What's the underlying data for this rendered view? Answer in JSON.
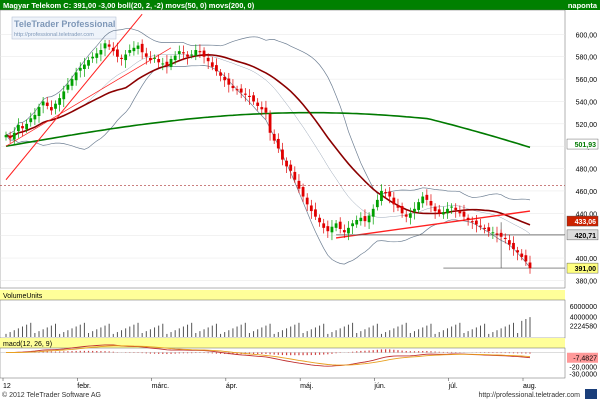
{
  "header": {
    "legend_text": "Magyar Telekom C: 391,00 -3,00 boll(20, 2, -2) movs(50, 0) movs(200, 0)",
    "timeframe": "naponta"
  },
  "watermark": {
    "brand": "TeleTrader Professional",
    "url": "http://professional.teletrader.com"
  },
  "footer": {
    "copyright": "© 2012 TeleTrader Software AG",
    "url": "http://professional.teletrader.com"
  },
  "x_axis": {
    "labels": [
      "12",
      "febr.",
      "márc.",
      "ápr.",
      "máj.",
      "jún.",
      "júl.",
      "aug."
    ]
  },
  "colors": {
    "up": "#00a000",
    "down": "#e00000",
    "ma50": "#8b0000",
    "ma200": "#007a00",
    "bollinger": "#6e7f93",
    "trendline": "#ff2020",
    "header_bg": "#008000",
    "panel_header_bg": "#ffff99",
    "price_tag": "#ffff80",
    "support_tag": "#cc2200"
  },
  "chart_data": [
    {
      "type": "candlestick",
      "title": "Magyar Telekom",
      "ylim": [
        375,
        620
      ],
      "y_ticks": [
        "600,00",
        "580,00",
        "560,00",
        "540,00",
        "520,00",
        "500,00",
        "480,00",
        "460,00",
        "440,00",
        "420,00",
        "400,00",
        "380,00"
      ],
      "y_tick_values": [
        600,
        580,
        560,
        540,
        520,
        500,
        480,
        460,
        440,
        420,
        400,
        380
      ],
      "close_series": [
        510,
        507,
        512,
        519,
        516,
        520,
        525,
        528,
        535,
        540,
        536,
        532,
        538,
        543,
        549,
        555,
        560,
        566,
        570,
        573,
        577,
        580,
        583,
        586,
        592,
        589,
        585,
        580,
        578,
        582,
        586,
        588,
        590,
        584,
        580,
        577,
        579,
        575,
        574,
        572,
        578,
        581,
        585,
        583,
        580,
        582,
        586,
        584,
        580,
        576,
        571,
        567,
        563,
        559,
        555,
        552,
        550,
        548,
        546,
        544,
        540,
        536,
        533,
        530,
        512,
        505,
        498,
        488,
        482,
        478,
        470,
        462,
        455,
        448,
        442,
        437,
        432,
        427,
        424,
        428,
        431,
        426,
        423,
        427,
        431,
        434,
        436,
        433,
        438,
        444,
        452,
        460,
        458,
        455,
        448,
        445,
        440,
        437,
        440,
        444,
        450,
        455,
        452,
        447,
        442,
        440,
        441,
        444,
        446,
        443,
        440,
        437,
        434,
        432,
        430,
        428,
        426,
        424,
        423,
        421,
        419,
        417,
        412,
        408,
        405,
        401,
        397,
        391
      ],
      "annotations": {
        "last_price": "391,00",
        "ma200_value": "501,93",
        "ma50_value": "433,06",
        "support_value": "420,71",
        "support_level": 420.71,
        "dashed_level": 465
      }
    },
    {
      "type": "bar",
      "title": "VolumeUnits",
      "ylim": [
        0,
        7000000
      ],
      "y_ticks": [
        "6000000",
        "4000000",
        "2224580"
      ],
      "y_tick_values": [
        6000000,
        4000000,
        2224580
      ],
      "last_volume": 2224580
    },
    {
      "type": "histogram+line",
      "title": "macd(12, 26, 9)",
      "ylim": [
        -35,
        5
      ],
      "y_ticks": [
        "-7,4827",
        "-20,0000",
        "-30,0000"
      ],
      "y_tick_values": [
        -7.4827,
        -20,
        -30
      ],
      "last_value": -7.4827
    }
  ]
}
